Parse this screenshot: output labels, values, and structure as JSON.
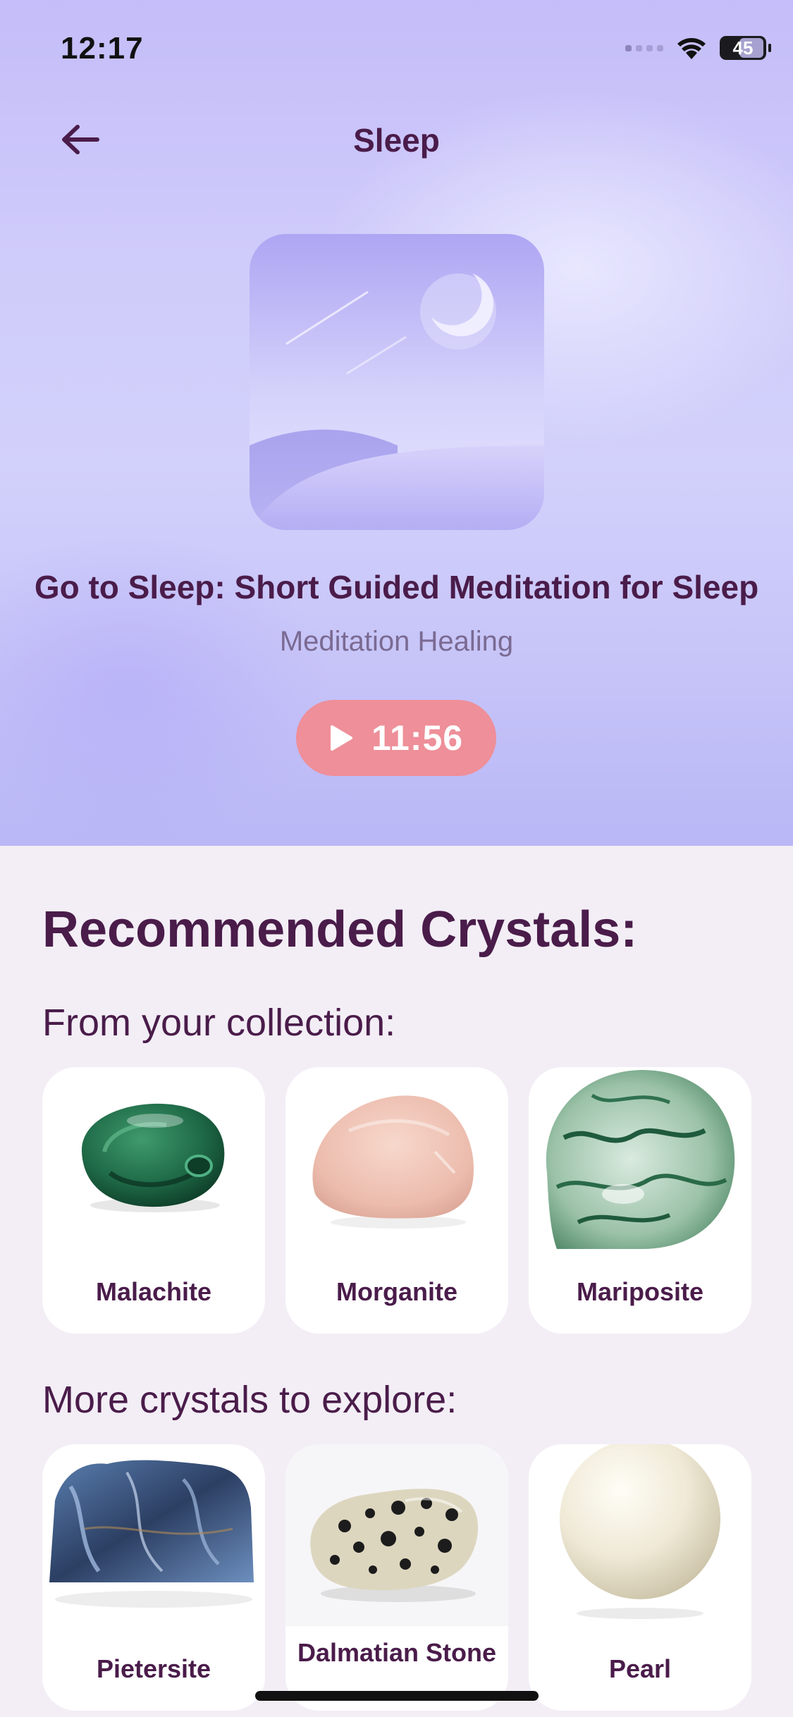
{
  "status_bar": {
    "time": "12:17",
    "battery": "45"
  },
  "header": {
    "title": "Sleep",
    "back_icon": "arrow-left-icon"
  },
  "track": {
    "title": "Go to Sleep: Short Guided Meditation for Sleep",
    "artist": "Meditation Healing",
    "duration": "11:56",
    "play_icon": "play-icon"
  },
  "recommendations": {
    "heading": "Recommended Crystals:",
    "collection_heading": "From your collection:",
    "collection": [
      {
        "name": "Malachite"
      },
      {
        "name": "Morganite"
      },
      {
        "name": "Mariposite"
      }
    ],
    "explore_heading": "More crystals to explore:",
    "explore": [
      {
        "name": "Pietersite"
      },
      {
        "name": "Dalmatian Stone"
      },
      {
        "name": "Pearl"
      }
    ]
  },
  "colors": {
    "accent_text": "#4a1c4a",
    "play_button": "#ee8f99",
    "hero_background": "#c8c4f9",
    "page_background": "#f3eef6"
  }
}
